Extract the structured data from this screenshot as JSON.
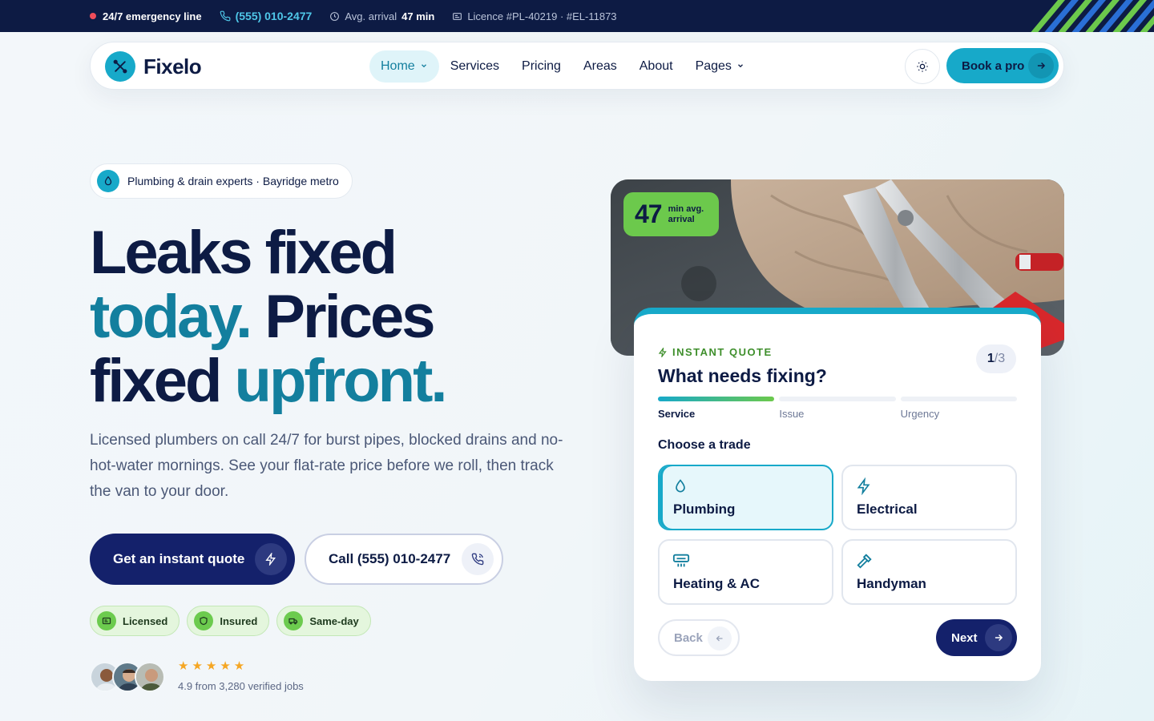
{
  "topbar": {
    "emergency": "24/7 emergency line",
    "phone": "(555) 010-2477",
    "arrival_label": "Avg. arrival",
    "arrival_value": "47 min",
    "licence": "Licence #PL-40219 · #EL-11873",
    "stripe_colors": [
      "#6cc94c",
      "#2a6fd6"
    ]
  },
  "brand": {
    "name": "Fixelo",
    "primary": "#17a9c9",
    "navy": "#0d1b44",
    "green": "#6cc94c",
    "teal_text": "#137f9e"
  },
  "nav": {
    "items": [
      {
        "label": "Home",
        "active": true,
        "dropdown": true
      },
      {
        "label": "Services"
      },
      {
        "label": "Pricing"
      },
      {
        "label": "Areas"
      },
      {
        "label": "About"
      },
      {
        "label": "Pages",
        "dropdown": true
      }
    ],
    "theme_toggle_icon": "sun-icon",
    "cta": "Book a pro"
  },
  "hero": {
    "badge": "Plumbing & drain experts · Bayridge metro",
    "headline_1": "Leaks fixed",
    "headline_2a": "today.",
    "headline_2b": "Prices",
    "headline_3a": "fixed",
    "headline_3b": "upfront.",
    "lead": "Licensed plumbers on call 24/7 for burst pipes, blocked drains and no-hot-water mornings. See your flat-rate price before we roll, then track the van to your door.",
    "cta_primary": "Get an instant quote",
    "cta_secondary": "Call (555) 010-2477",
    "trust": [
      "Licensed",
      "Insured",
      "Same-day"
    ],
    "rating_stars": "★★★★★",
    "rating_text": "4.9 from 3,280 verified jobs"
  },
  "eta": {
    "value": "47",
    "label": "min avg. arrival"
  },
  "quote": {
    "kicker": "INSTANT QUOTE",
    "title": "What needs fixing?",
    "step_current": "1",
    "step_total": "/3",
    "steps": [
      "Service",
      "Issue",
      "Urgency"
    ],
    "active_step": 0,
    "choose_label": "Choose a trade",
    "options": [
      {
        "label": "Plumbing",
        "icon": "droplet-icon",
        "selected": true
      },
      {
        "label": "Electrical",
        "icon": "bolt-icon"
      },
      {
        "label": "Heating & AC",
        "icon": "ac-unit-icon"
      },
      {
        "label": "Handyman",
        "icon": "hammer-icon"
      }
    ],
    "back": "Back",
    "next": "Next"
  }
}
